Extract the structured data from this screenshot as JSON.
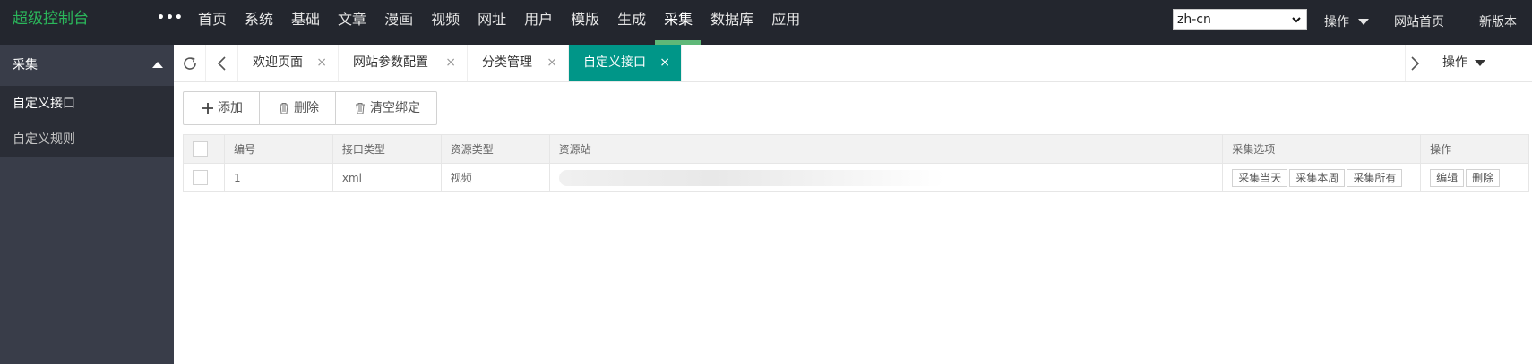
{
  "header": {
    "logo": "超级控制台",
    "more": "•••",
    "nav": [
      "首页",
      "系统",
      "基础",
      "文章",
      "漫画",
      "视频",
      "网址",
      "用户",
      "模版",
      "生成",
      "采集",
      "数据库",
      "应用"
    ],
    "active_nav": "采集",
    "language": "zh-cn",
    "operations_label": "操作",
    "site_home_label": "网站首页",
    "new_version_label": "新版本"
  },
  "sidebar": {
    "group_label": "采集",
    "items": [
      {
        "label": "自定义接口",
        "active": true
      },
      {
        "label": "自定义规则",
        "active": false
      }
    ]
  },
  "tabs": {
    "items": [
      {
        "label": "欢迎页面",
        "active": false
      },
      {
        "label": "网站参数配置",
        "active": false
      },
      {
        "label": "分类管理",
        "active": false
      },
      {
        "label": "自定义接口",
        "active": true
      }
    ],
    "close_glyph": "×",
    "operations_label": "操作"
  },
  "toolbar": {
    "add_label": "添加",
    "delete_label": "删除",
    "clear_label": "清空绑定"
  },
  "table": {
    "headers": [
      "编号",
      "接口类型",
      "资源类型",
      "资源站",
      "采集选项",
      "操作"
    ],
    "rows": [
      {
        "id": "1",
        "interface_type": "xml",
        "resource_type": "视频",
        "resource_site": "",
        "collect_options": [
          "采集当天",
          "采集本周",
          "采集所有"
        ],
        "actions": [
          "编辑",
          "删除"
        ]
      }
    ]
  },
  "colors": {
    "header_bg": "#23262e",
    "sidebar_bg": "#393d49",
    "accent": "#009688",
    "logo": "#2bb75b",
    "nav_active_bar": "#5fb878"
  },
  "icons": [
    "refresh-icon",
    "chevron-left-icon",
    "chevron-right-icon",
    "plus-icon",
    "trash-icon",
    "close-icon",
    "caret-down-icon",
    "caret-up-icon"
  ]
}
